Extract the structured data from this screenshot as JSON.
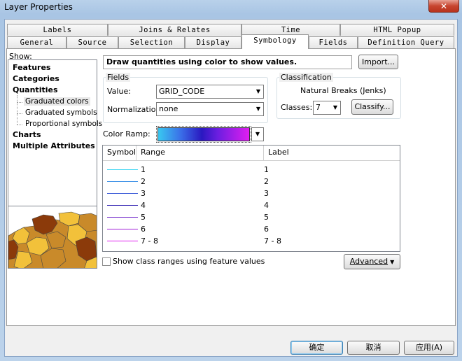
{
  "window": {
    "title": "Layer Properties",
    "close_glyph": "✕"
  },
  "tabs_back": [
    "Labels",
    "Joins & Relates",
    "Time",
    "HTML Popup"
  ],
  "tabs_front": [
    "General",
    "Source",
    "Selection",
    "Display",
    "Symbology",
    "Fields",
    "Definition Query"
  ],
  "active_tab": "Symbology",
  "show": {
    "label": "Show:",
    "items": [
      "Features",
      "Categories",
      "Quantities"
    ],
    "sub_items": [
      "Graduated colors",
      "Graduated symbols",
      "Proportional symbols"
    ],
    "items_after": [
      "Charts",
      "Multiple Attributes"
    ],
    "selected": "Graduated colors"
  },
  "description": "Draw quantities using color to show values.",
  "import_label": "Import...",
  "fields": {
    "legend": "Fields",
    "value_label": "Value:",
    "value": "GRID_CODE",
    "normalization_label": "Normalization:",
    "normalization": "none"
  },
  "classification": {
    "legend": "Classification",
    "method": "Natural Breaks (Jenks)",
    "classes_label": "Classes:",
    "classes": "7",
    "classify_label": "Classify..."
  },
  "color_ramp_label": "Color Ramp:",
  "table": {
    "headers": [
      "Symbol",
      "Range",
      "Label"
    ],
    "rows": [
      {
        "range": "1",
        "label": "1",
        "color": "#3fd6f2"
      },
      {
        "range": "2",
        "label": "2",
        "color": "#3a8fe6"
      },
      {
        "range": "3",
        "label": "3",
        "color": "#3a5ad8"
      },
      {
        "range": "4",
        "label": "4",
        "color": "#2a1ab0"
      },
      {
        "range": "5",
        "label": "5",
        "color": "#6a1ec8"
      },
      {
        "range": "6",
        "label": "6",
        "color": "#a01ed8"
      },
      {
        "range": "7 - 8",
        "label": "7 - 8",
        "color": "#e01ef0"
      }
    ]
  },
  "show_class_ranges_label": "Show class ranges using feature values",
  "advanced_label": "Advanced",
  "footer": {
    "ok": "确定",
    "cancel": "取消",
    "apply": "应用(A)"
  },
  "colors": {
    "map_brown": "#8b3a0a",
    "map_yellow": "#f2c13a",
    "map_tan": "#c98a2a",
    "map_water": "#ffffff"
  }
}
